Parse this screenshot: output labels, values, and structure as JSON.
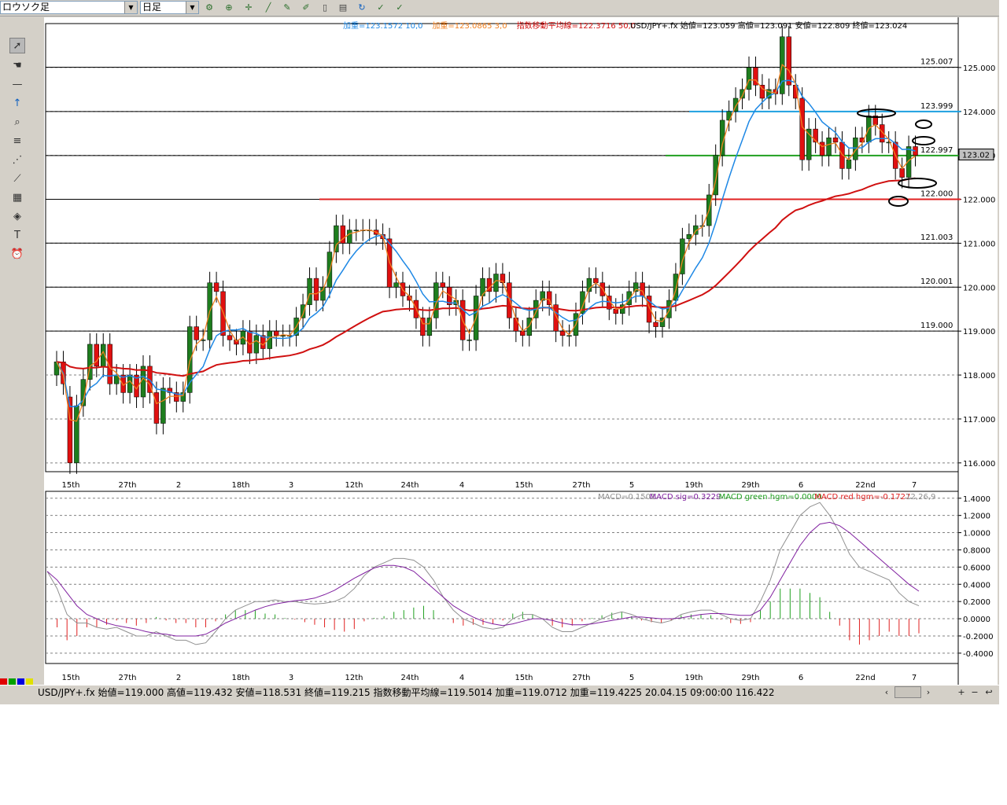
{
  "toolbar": {
    "chart_type": "ロウソク足",
    "timeframe": "日足",
    "buttons": [
      "wrench-icon",
      "zoom-icon",
      "crosshair-icon",
      "line-tool-icon",
      "edit-icon",
      "edit2-icon",
      "page-icon",
      "print-icon",
      "refresh-icon",
      "check-icon",
      "check2-icon"
    ]
  },
  "left_tools": [
    "cursor-icon",
    "hand-icon",
    "hline-icon",
    "arrow-up-icon",
    "zoom-tool-icon",
    "fibonacci-icon",
    "fan-icon",
    "trend-icon",
    "calculator-icon",
    "paint-icon",
    "text-icon",
    "alarm-icon"
  ],
  "price_chart": {
    "legend": [
      {
        "text": "加重=123.1572  10,0",
        "color": "#1e88e5"
      },
      {
        "text": "加重=123.0865  3,0",
        "color": "#f08020"
      },
      {
        "text": "指数移動平均線=122.3716  50,0",
        "color": "#d01010"
      },
      {
        "text": "USD/JPY+.fx 始値=123.059 高値=123.091 安値=122.809 終値=123.024",
        "color": "#000000"
      }
    ],
    "price_labels": [
      {
        "y": 116.0,
        "label": "116.000"
      },
      {
        "y": 117.0,
        "label": "117.000"
      },
      {
        "y": 118.0,
        "label": "118.000"
      },
      {
        "y": 119.0,
        "label": "119.000"
      },
      {
        "y": 120.0,
        "label": "120.000"
      },
      {
        "y": 121.0,
        "label": "121.000"
      },
      {
        "y": 122.0,
        "label": "122.000"
      },
      {
        "y": 123.0,
        "label": "123.000"
      },
      {
        "y": 124.0,
        "label": "124.000"
      },
      {
        "y": 125.0,
        "label": "125.000"
      }
    ],
    "level_labels": [
      {
        "y": 125.007,
        "label": "125.007"
      },
      {
        "y": 123.999,
        "label": "123.999"
      },
      {
        "y": 122.997,
        "label": "122.997"
      },
      {
        "y": 122.0,
        "label": "122.000"
      },
      {
        "y": 121.003,
        "label": "121.003"
      },
      {
        "y": 120.001,
        "label": "120.001"
      },
      {
        "y": 119.0,
        "label": "119.000"
      }
    ],
    "current_price": "123.02",
    "colors": {
      "up": "#1e7d1e",
      "down": "#e01010",
      "ema50": "#d01010",
      "wma10": "#1e88e5",
      "wma3": "#f08020",
      "hline_blue": "#1ea0e0",
      "hline_green": "#20a020",
      "hline_red": "#e02020"
    }
  },
  "x_labels": [
    "15th",
    "27th",
    "2",
    "18th",
    "3",
    "12th",
    "24th",
    "4",
    "15th",
    "27th",
    "5",
    "19th",
    "29th",
    "6",
    "22nd",
    "7"
  ],
  "macd_chart": {
    "legend": [
      {
        "text": "MACD=0.1501",
        "color": "#909090"
      },
      {
        "text": "MACD sig=0.3229",
        "color": "#8020a0"
      },
      {
        "text": "MACD green hgm=0.0000",
        "color": "#20a020"
      },
      {
        "text": "MACD red hgm=-0.1727",
        "color": "#e02020"
      },
      {
        "text": "12,26,9",
        "color": "#909090"
      }
    ],
    "labels": [
      {
        "y": 1.4,
        "label": "1.4000"
      },
      {
        "y": 1.2,
        "label": "1.2000"
      },
      {
        "y": 1.0,
        "label": "1.0000"
      },
      {
        "y": 0.8,
        "label": "0.8000"
      },
      {
        "y": 0.6,
        "label": "0.6000"
      },
      {
        "y": 0.4,
        "label": "0.4000"
      },
      {
        "y": 0.2,
        "label": "0.2000"
      },
      {
        "y": 0.0,
        "label": "0.0000"
      },
      {
        "y": -0.2,
        "label": "-0.2000"
      },
      {
        "y": -0.4,
        "label": "-0.4000"
      }
    ]
  },
  "chart_data": {
    "type": "candlestick",
    "closes": [
      118.3,
      117.8,
      116.0,
      117.3,
      117.9,
      118.7,
      118.2,
      118.7,
      117.8,
      118.0,
      117.6,
      118.0,
      117.5,
      118.2,
      117.6,
      116.9,
      117.7,
      117.6,
      117.4,
      117.6,
      119.1,
      118.8,
      118.8,
      120.1,
      119.9,
      118.9,
      118.8,
      118.7,
      119.0,
      118.5,
      118.9,
      118.6,
      119.0,
      118.9,
      118.9,
      118.9,
      119.3,
      119.6,
      120.2,
      119.7,
      120.0,
      120.8,
      121.4,
      121.0,
      121.3,
      121.3,
      121.3,
      121.3,
      121.2,
      121.1,
      120.0,
      120.1,
      119.8,
      119.7,
      119.3,
      118.9,
      119.3,
      120.1,
      120.0,
      119.6,
      119.7,
      118.8,
      118.8,
      119.8,
      120.2,
      119.9,
      120.3,
      120.1,
      119.3,
      119.0,
      118.9,
      119.3,
      119.7,
      119.9,
      119.6,
      119.0,
      118.9,
      118.9,
      119.4,
      119.9,
      120.2,
      120.1,
      119.8,
      119.5,
      119.4,
      119.6,
      119.9,
      120.1,
      119.8,
      119.2,
      119.1,
      119.3,
      119.7,
      120.3,
      121.1,
      121.2,
      121.4,
      121.4,
      122.1,
      123.0,
      123.8,
      124.0,
      124.3,
      124.5,
      125.0,
      124.6,
      124.3,
      124.5,
      124.4,
      125.7,
      124.6,
      124.3,
      122.9,
      123.6,
      123.3,
      123.0,
      123.4,
      123.3,
      122.7,
      122.9,
      123.4,
      123.3,
      123.9,
      123.7,
      123.3,
      123.3,
      122.7,
      122.5,
      123.2,
      123.0
    ],
    "opens": [
      118.0,
      118.3,
      117.5,
      116.0,
      117.3,
      117.9,
      118.7,
      118.2,
      118.7,
      117.8,
      118.0,
      117.6,
      118.0,
      117.5,
      118.2,
      117.6,
      116.9,
      117.7,
      117.6,
      117.4,
      117.6,
      119.1,
      118.8,
      118.8,
      120.1,
      119.9,
      118.9,
      118.8,
      118.7,
      119.0,
      118.5,
      118.9,
      118.6,
      119.0,
      118.9,
      118.9,
      118.9,
      119.3,
      119.6,
      120.2,
      119.7,
      120.0,
      120.8,
      121.4,
      121.0,
      121.3,
      121.3,
      121.3,
      121.3,
      121.2,
      121.1,
      120.0,
      120.1,
      119.8,
      119.7,
      119.3,
      118.9,
      119.3,
      120.1,
      120.0,
      119.6,
      119.7,
      118.8,
      118.8,
      119.8,
      120.2,
      119.9,
      120.3,
      120.1,
      119.3,
      119.0,
      118.9,
      119.3,
      119.7,
      119.9,
      119.6,
      119.0,
      118.9,
      118.9,
      119.4,
      119.9,
      120.2,
      120.1,
      119.8,
      119.5,
      119.4,
      119.6,
      119.9,
      120.1,
      119.8,
      119.2,
      119.1,
      119.3,
      119.7,
      120.3,
      121.1,
      121.2,
      121.4,
      121.4,
      122.1,
      123.0,
      123.8,
      124.0,
      124.3,
      124.5,
      125.0,
      124.6,
      124.3,
      124.5,
      124.4,
      125.7,
      124.6,
      124.3,
      122.9,
      123.6,
      123.3,
      123.0,
      123.4,
      123.3,
      122.7,
      122.9,
      123.4,
      123.3,
      123.9,
      123.7,
      123.3,
      123.3,
      122.7,
      122.5,
      123.2
    ],
    "x_range": [
      0,
      130
    ],
    "y_range": [
      115.8,
      126.0
    ],
    "macd": [
      0.55,
      0.35,
      0.05,
      -0.05,
      -0.05,
      -0.1,
      -0.12,
      -0.1,
      -0.15,
      -0.2,
      -0.2,
      -0.15,
      -0.2,
      -0.25,
      -0.25,
      -0.3,
      -0.28,
      -0.15,
      0.0,
      0.1,
      0.15,
      0.2,
      0.2,
      0.22,
      0.2,
      0.2,
      0.18,
      0.17,
      0.18,
      0.2,
      0.25,
      0.35,
      0.5,
      0.6,
      0.65,
      0.7,
      0.7,
      0.68,
      0.6,
      0.45,
      0.25,
      0.1,
      0.0,
      -0.05,
      -0.1,
      -0.12,
      -0.1,
      0.0,
      0.05,
      0.05,
      0.0,
      -0.1,
      -0.15,
      -0.15,
      -0.1,
      -0.05,
      0.0,
      0.05,
      0.08,
      0.05,
      0.0,
      -0.03,
      -0.05,
      -0.02,
      0.05,
      0.08,
      0.1,
      0.1,
      0.05,
      0.0,
      -0.02,
      0.0,
      0.2,
      0.45,
      0.8,
      1.0,
      1.2,
      1.3,
      1.35,
      1.2,
      1.0,
      0.75,
      0.6,
      0.55,
      0.5,
      0.45,
      0.3,
      0.2,
      0.15
    ],
    "signal": [
      0.55,
      0.45,
      0.3,
      0.15,
      0.05,
      0.0,
      -0.05,
      -0.08,
      -0.1,
      -0.12,
      -0.15,
      -0.17,
      -0.18,
      -0.2,
      -0.2,
      -0.2,
      -0.18,
      -0.12,
      -0.05,
      0.0,
      0.05,
      0.1,
      0.14,
      0.17,
      0.19,
      0.21,
      0.22,
      0.24,
      0.28,
      0.33,
      0.4,
      0.47,
      0.53,
      0.59,
      0.62,
      0.62,
      0.6,
      0.55,
      0.45,
      0.35,
      0.25,
      0.15,
      0.08,
      0.02,
      -0.03,
      -0.06,
      -0.08,
      -0.06,
      -0.03,
      0.0,
      0.0,
      -0.02,
      -0.05,
      -0.07,
      -0.07,
      -0.06,
      -0.04,
      -0.02,
      0.0,
      0.02,
      0.02,
      0.01,
      0.0,
      0.0,
      0.01,
      0.03,
      0.05,
      0.06,
      0.06,
      0.05,
      0.04,
      0.04,
      0.1,
      0.25,
      0.45,
      0.65,
      0.85,
      1.0,
      1.1,
      1.12,
      1.08,
      1.0,
      0.9,
      0.8,
      0.7,
      0.6,
      0.5,
      0.4,
      0.32
    ],
    "price_axis_min": 116.0,
    "price_axis_max": 125.0
  },
  "status": {
    "text": "USD/JPY+.fx 始値=119.000 高値=119.432 安値=118.531 終値=119.215  指数移動平均線=119.5014 加重=119.0712 加重=119.4225  20.04.15 09:00:00 116.422",
    "nav": [
      "‹",
      "›",
      "+",
      "−",
      "↩"
    ]
  }
}
